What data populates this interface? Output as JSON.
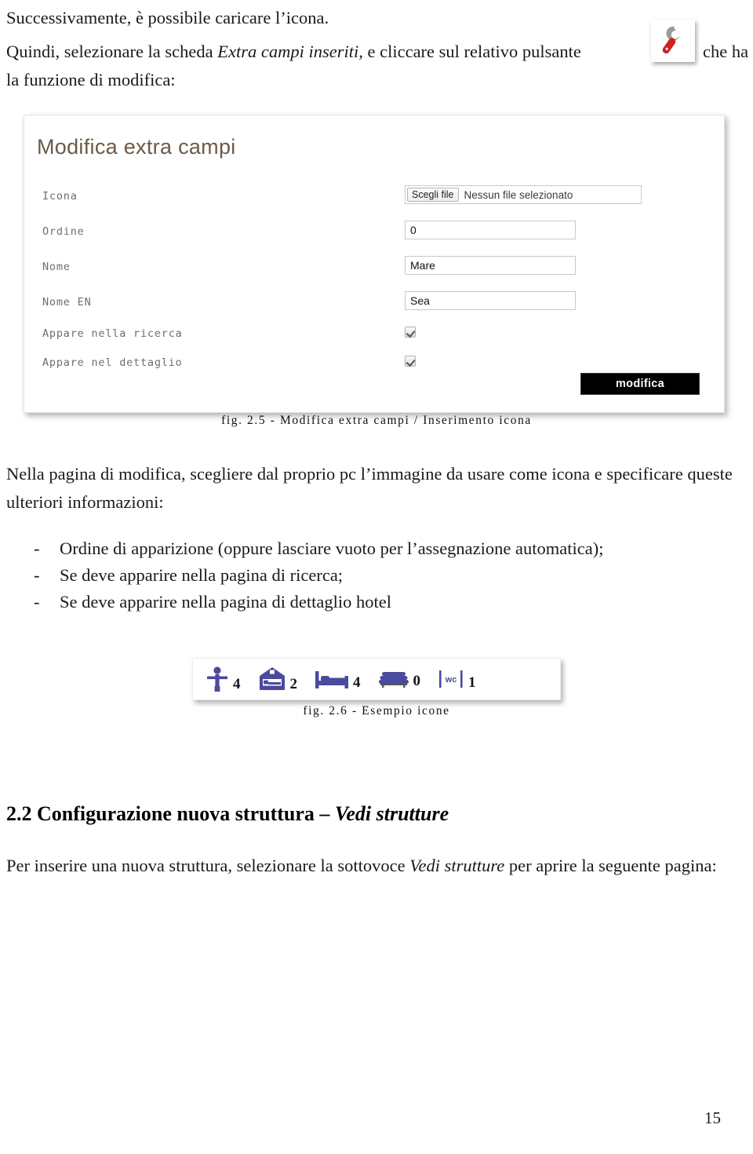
{
  "document": {
    "intro_line": "Successivamente, è possibile caricare l’icona.",
    "instruction": {
      "before_italic": "Quindi, selezionare la scheda ",
      "italic": "Extra campi inseriti,",
      "after_italic": " e cliccare sul relativo pulsante",
      "tail": "che ha",
      "second_line": "la funzione di modifica:"
    },
    "body_paragraph": "Nella pagina di modifica, scegliere dal proprio pc l’immagine da usare come icona e specificare queste ulteriori informazioni:",
    "bullets": [
      {
        "dash": "-",
        "text": "Ordine di apparizione (oppure lasciare vuoto per l’assegnazione automatica);"
      },
      {
        "dash": "-",
        "text": "Se deve apparire nella pagina di ricerca;"
      },
      {
        "dash": "-",
        "text": "Se deve apparire nella pagina di dettaglio hotel"
      }
    ],
    "section": {
      "heading_number": "2.2",
      "heading_plain": "Configurazione nuova struttura – ",
      "heading_italic": "Vedi strutture",
      "paragraph_before": "Per inserire una nuova struttura, selezionare la sottovoce ",
      "paragraph_italic": "Vedi strutture",
      "paragraph_after": " per aprire la seguente pagina:"
    },
    "page_number": "15"
  },
  "figure_25": {
    "caption": "fig. 2.5 - Modifica extra campi / Inserimento icona",
    "form_title": "Modifica extra campi",
    "rows": [
      {
        "label": "Icona",
        "type": "file",
        "button_label": "Scegli file",
        "value": "Nessun file selezionato"
      },
      {
        "label": "Ordine",
        "type": "text",
        "value": "0"
      },
      {
        "label": "Nome",
        "type": "text",
        "value": "Mare"
      },
      {
        "label": "Nome EN",
        "type": "text",
        "value": "Sea"
      },
      {
        "label": "Appare nella ricerca",
        "type": "checkbox",
        "checked": true
      },
      {
        "label": "Appare nel dettaglio",
        "type": "checkbox",
        "checked": true
      }
    ],
    "submit_label": "modifica",
    "title_color": "#6b5a46",
    "submit_background": "#000000"
  },
  "figure_26": {
    "caption": "fig. 2.6 - Esempio icone",
    "icon_color": "#4a4a9e",
    "icons": [
      {
        "name": "person-icon",
        "count": "4"
      },
      {
        "name": "bedroom-house-icon",
        "count": "2"
      },
      {
        "name": "bed-icon",
        "count": "4"
      },
      {
        "name": "sofa-icon",
        "count": "0"
      },
      {
        "name": "wc-icon",
        "count": "1",
        "glyph": "wc"
      }
    ]
  },
  "toolbar_icon": {
    "name": "wrench-icon",
    "head_color": "#9a9a9a",
    "handle_color": "#cc2222"
  }
}
